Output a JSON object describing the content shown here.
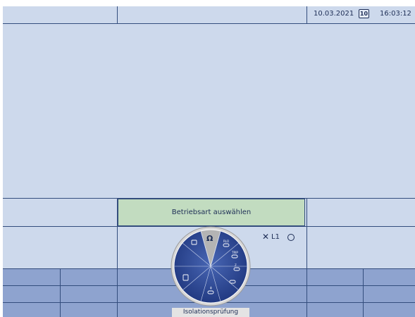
{
  "header": {
    "date": "10.03.2021",
    "calendar_badge": "10",
    "time": "16:03:12"
  },
  "mode_bar": {
    "label": "Betriebsart auswählen"
  },
  "probe": {
    "x_mark": "✕",
    "label": "L1"
  },
  "dial": {
    "selected_symbol": "Ω",
    "caption": "Isolationsprüfung",
    "segments": [
      {
        "icon": "insulation-test-icon",
        "text": "Ω"
      },
      {
        "icon": "rlo-icon",
        "text": "RLO"
      },
      {
        "icon": "trip-time-icon",
        "text": "TRIP"
      },
      {
        "icon": "loop-test-icon",
        "text": "Z"
      },
      {
        "icon": "earth-icon",
        "text": ""
      },
      {
        "icon": "phase-icon",
        "text": ""
      },
      {
        "icon": "rcd-icon",
        "text": ""
      },
      {
        "icon": "voltage-icon",
        "text": ""
      }
    ]
  },
  "colors": {
    "background": "#cdd9ec",
    "grid_line": "#334d7d",
    "mode_bar": "#c2dcc0",
    "table_rows": "#8ea3cf",
    "dial_face": "#2f4a98",
    "dial_selected": "#b4b4b4"
  }
}
